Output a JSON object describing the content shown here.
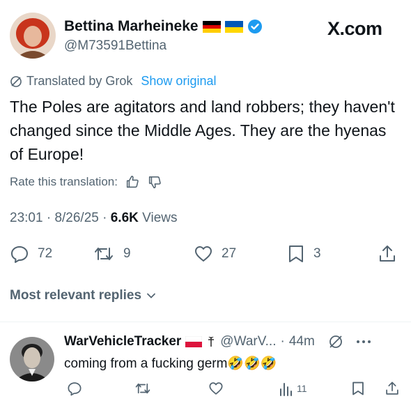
{
  "post": {
    "author_name": "Bettina Marheineke",
    "author_handle": "@M73591Bettina",
    "author_flags": [
      "germany-flag-icon",
      "ukraine-flag-icon"
    ],
    "verified": true,
    "site_label": "X.com",
    "translated_label": "Translated by Grok",
    "show_original_label": "Show original",
    "text": "The Poles are agitators and land robbers; they haven't changed since the Middle Ages. They are the hyenas of Europe!",
    "rate_label": "Rate this translation:",
    "time": "23:01",
    "date": "8/26/25",
    "views_count": "6.6K",
    "views_label": "Views",
    "separator": "·",
    "actions": {
      "replies": "72",
      "reposts": "9",
      "likes": "27",
      "bookmarks": "3"
    }
  },
  "replies_section": {
    "title": "Most relevant replies"
  },
  "reply": {
    "author_name": "WarVehicleTracker",
    "author_badges": [
      "poland-flag-icon",
      "cross-symbol-icon"
    ],
    "author_handle": "@WarV...",
    "separator": "·",
    "time": "44m",
    "text": "coming from a fucking germ",
    "emojis": "🤣🤣🤣",
    "actions": {
      "views": "11"
    }
  },
  "colors": {
    "text_primary": "#0f1419",
    "text_secondary": "#536471",
    "link": "#1d9bf0",
    "verified": "#1d9bf0",
    "divider": "#eff3f4"
  }
}
